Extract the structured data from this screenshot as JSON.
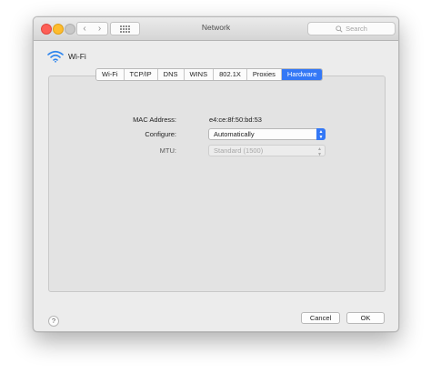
{
  "window": {
    "title": "Network"
  },
  "toolbar": {
    "back_icon": "chevron-left",
    "forward_icon": "chevron-right",
    "grid_icon": "grid"
  },
  "search": {
    "placeholder": "Search"
  },
  "interface": {
    "name": "Wi-Fi",
    "icon": "wifi"
  },
  "tabs": [
    {
      "label": "Wi-Fi",
      "active": false
    },
    {
      "label": "TCP/IP",
      "active": false
    },
    {
      "label": "DNS",
      "active": false
    },
    {
      "label": "WINS",
      "active": false
    },
    {
      "label": "802.1X",
      "active": false
    },
    {
      "label": "Proxies",
      "active": false
    },
    {
      "label": "Hardware",
      "active": true
    }
  ],
  "hardware": {
    "mac_label": "MAC Address:",
    "mac_value": "e4:ce:8f:50:bd:53",
    "configure_label": "Configure:",
    "configure_value": "Automatically",
    "mtu_label": "MTU:",
    "mtu_value": "Standard  (1500)"
  },
  "footer": {
    "help": "?",
    "cancel": "Cancel",
    "ok": "OK"
  },
  "colors": {
    "accent": "#3478f6",
    "close": "#fd5f57",
    "minimize": "#febc2e"
  }
}
